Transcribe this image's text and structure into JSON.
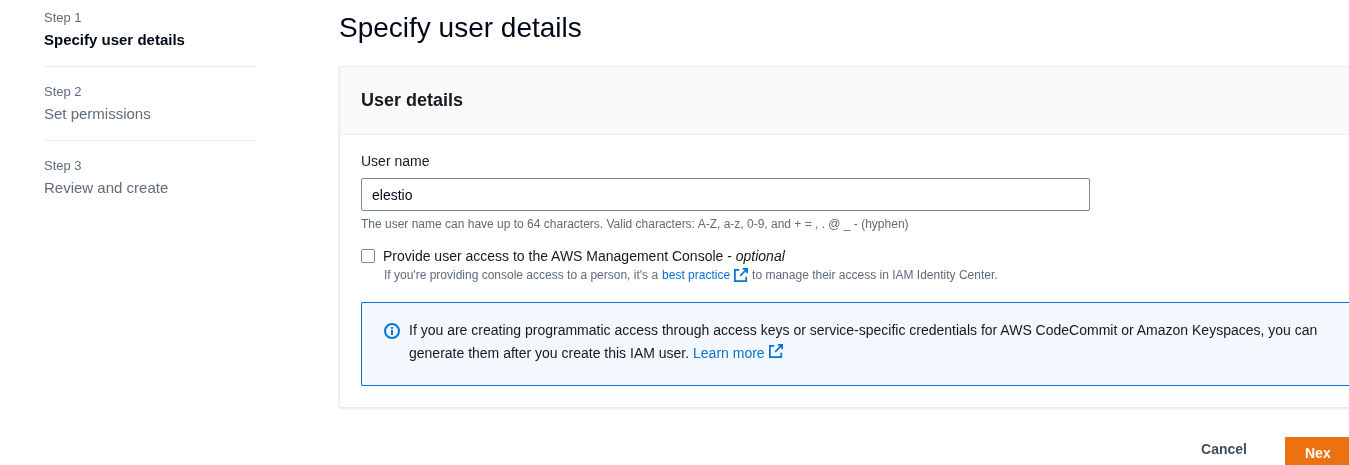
{
  "steps": [
    {
      "step": "Step 1",
      "title": "Specify user details",
      "selected": true
    },
    {
      "step": "Step 2",
      "title": "Set permissions",
      "selected": false
    },
    {
      "step": "Step 3",
      "title": "Review and create",
      "selected": false
    }
  ],
  "page_title": "Specify user details",
  "panel": {
    "header": "User details",
    "user_name": {
      "label": "User name",
      "value": "elestio",
      "hint": "The user name can have up to 64 characters. Valid characters: A-Z, a-z, 0-9, and + = , . @ _ - (hyphen)"
    },
    "console_access": {
      "label": "Provide user access to the AWS Management Console - *optional*",
      "checked": false,
      "description_before": "If you're providing console access to a person, it's a",
      "description_link": "best practice",
      "description_after": "to manage their access in IAM Identity Center."
    },
    "info": {
      "text": "If you are creating programmatic access through access keys or service-specific credentials for AWS CodeCommit or Amazon Keyspaces, you can generate them after you create this IAM user.",
      "link": "Learn more"
    }
  },
  "footer": {
    "cancel": "Cancel",
    "next": "Nex"
  }
}
